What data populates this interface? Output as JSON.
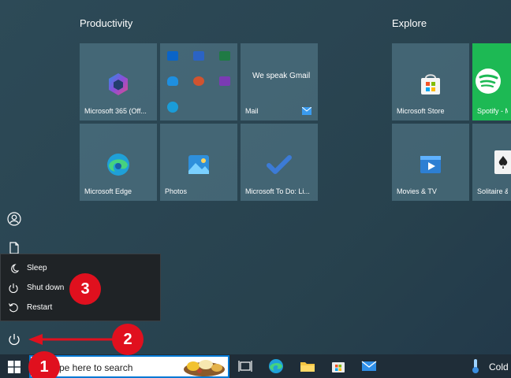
{
  "groups": {
    "productivity": "Productivity",
    "explore": "Explore"
  },
  "tiles": {
    "m365": "Microsoft 365 (Off...",
    "office_apps": [
      "outlook-icon",
      "word-icon",
      "excel-icon",
      "onedrive-icon",
      "powerpoint-icon",
      "onenote-icon",
      "skype-icon"
    ],
    "mail_promo": "We speak Gmail",
    "mail": "Mail",
    "edge": "Microsoft Edge",
    "photos": "Photos",
    "todo": "Microsoft To Do: Li...",
    "store": "Microsoft Store",
    "spotify": "Spotify - Music",
    "movies": "Movies & TV",
    "solitaire": "Solitaire &"
  },
  "power_menu": {
    "items": [
      "Sleep",
      "Shut down",
      "Restart"
    ]
  },
  "annotations": {
    "badge1": "1",
    "badge2": "2",
    "badge3": "3"
  },
  "taskbar": {
    "search_placeholder": "ype here to search",
    "weather": "Cold w"
  },
  "colors": {
    "spotify": "#1db954",
    "badge": "#e0101e",
    "accent": "#0078d4"
  }
}
